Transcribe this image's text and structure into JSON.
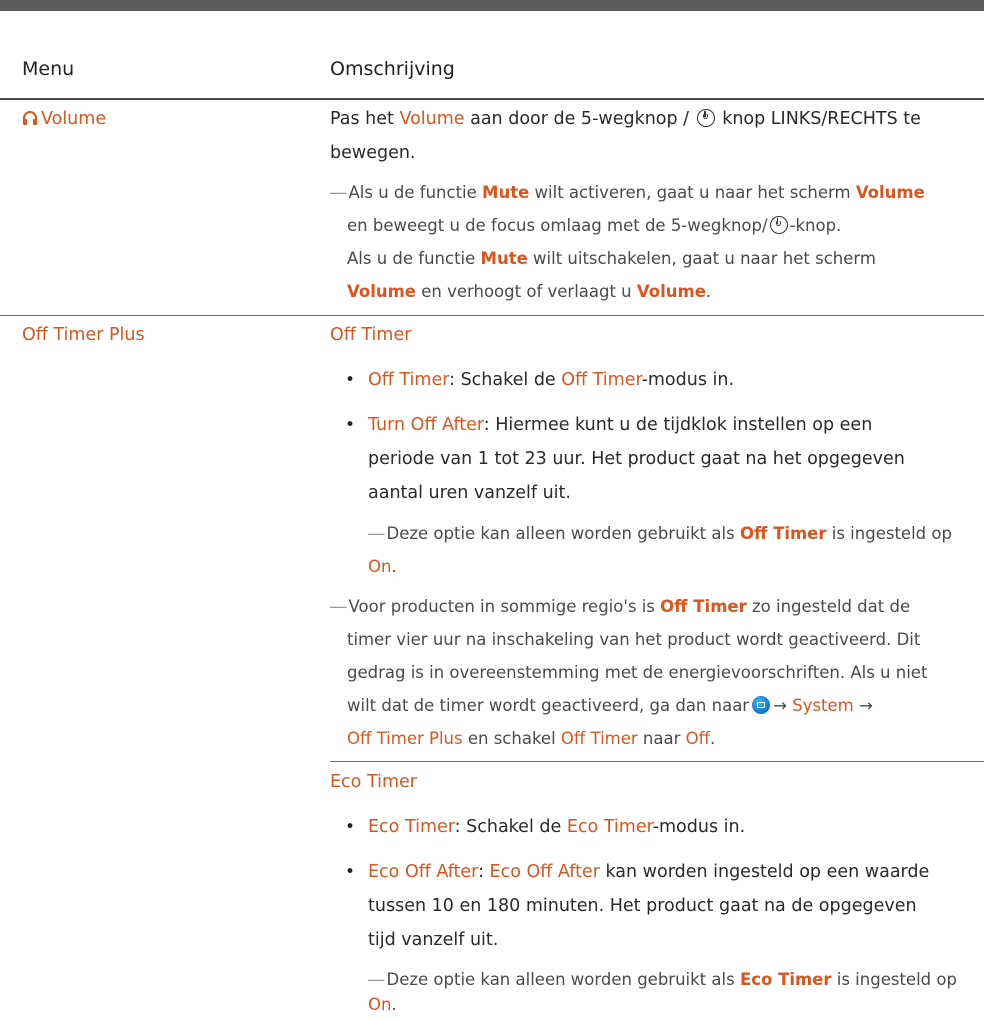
{
  "header": {
    "col_menu": "Menu",
    "col_desc": "Omschrijving"
  },
  "volume": {
    "menu_label": "Volume",
    "desc_l1_pre": "Pas het ",
    "desc_l1_vol": "Volume",
    "desc_l1_mid": " aan door de 5-wegknop / ",
    "desc_l1_post": " knop LINKS/RECHTS te",
    "desc_l2": "bewegen.",
    "note_l1_pre": "Als u de functie ",
    "note_l1_mute": "Mute",
    "note_l1_mid": " wilt activeren, gaat u naar het scherm ",
    "note_l1_vol": "Volume",
    "note_l2_pre": "en beweegt u de focus omlaag met de 5-wegknop/",
    "note_l2_post": "-knop.",
    "note_l3_pre": "Als u de functie ",
    "note_l3_mute": "Mute",
    "note_l3_post": " wilt uitschakelen, gaat u naar het scherm",
    "note_l4_vol": "Volume",
    "note_l4_mid": " en verhoogt of verlaagt u ",
    "note_l4_vol2": "Volume",
    "note_l4_post": "."
  },
  "offtimer": {
    "menu_label": "Off Timer Plus",
    "section_title": "Off Timer",
    "b1_label": "Off Timer",
    "b1_mid": ": Schakel de ",
    "b1_label2": "Off Timer",
    "b1_post": "-modus in.",
    "b2_label": "Turn Off After",
    "b2_l1": ": Hiermee kunt u de tijdklok instellen op een",
    "b2_l2": "periode van 1 tot 23 uur. Het product gaat na het opgegeven",
    "b2_l3": "aantal uren vanzelf uit.",
    "n1_pre": "Deze optie kan alleen worden gebruikt als ",
    "n1_label": "Off Timer",
    "n1_post": " is ingesteld op",
    "n1_on": "On",
    "n1_dot": ".",
    "n2_l1_pre": "Voor producten in sommige regio's is ",
    "n2_l1_label": "Off Timer",
    "n2_l1_post": " zo ingesteld dat de",
    "n2_l2": "timer vier uur na inschakeling van het product wordt geactiveerd. Dit",
    "n2_l3": "gedrag is in overeenstemming met de energievoorschriften. Als u niet",
    "n2_l4_pre": "wilt dat de timer wordt geactiveerd, ga dan naar",
    "arrow": "→",
    "system": "System",
    "n2_l5_otp": "Off Timer Plus",
    "n2_l5_mid": " en schakel ",
    "n2_l5_ot": "Off Timer",
    "n2_l5_naar": " naar ",
    "n2_l5_off": "Off",
    "n2_l5_dot": "."
  },
  "ecotimer": {
    "section_title": "Eco Timer",
    "b1_label": "Eco Timer",
    "b1_mid": ": Schakel de ",
    "b1_label2": "Eco Timer",
    "b1_post": "-modus in.",
    "b2_label": "Eco Off After",
    "b2_colon": ": ",
    "b2_label2": "Eco Off After",
    "b2_l1": " kan worden ingesteld op een waarde",
    "b2_l2": "tussen 10 en 180 minuten. Het product gaat na de opgegeven",
    "b2_l3": "tijd vanzelf uit.",
    "n1_pre": "Deze optie kan alleen worden gebruikt als ",
    "n1_label": "Eco Timer",
    "n1_post": " is ingesteld op",
    "n1_on": "On",
    "n1_dot": "."
  },
  "note_dash": "―",
  "bullet_char": "•",
  "colors": {
    "accent": "#d8561f",
    "text": "#222222",
    "rule": "#6b6b6b"
  }
}
